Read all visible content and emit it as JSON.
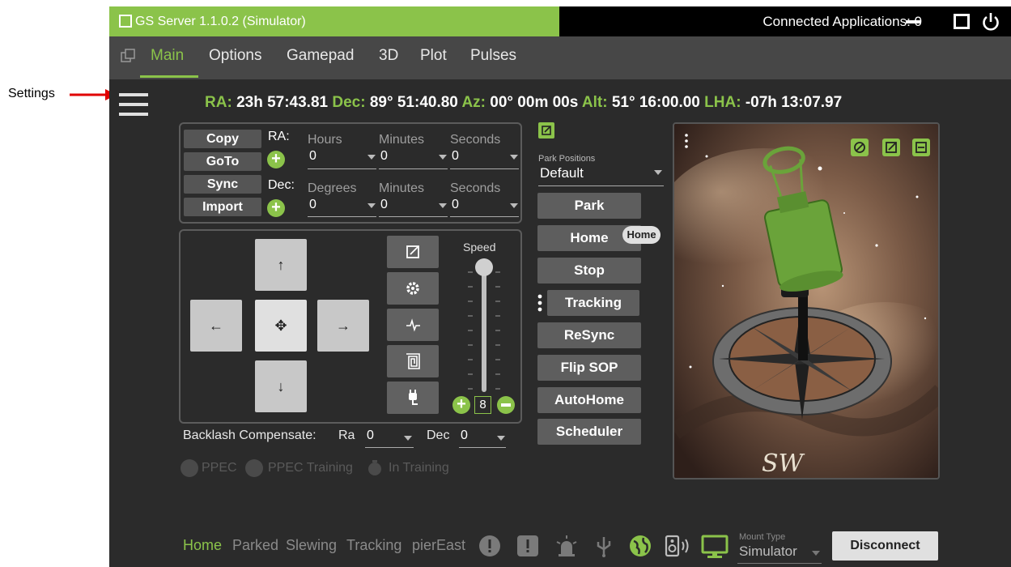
{
  "annotation": {
    "label": "Settings"
  },
  "window": {
    "title": "GS Server 1.1.0.2 (Simulator)",
    "connected_apps": "Connected Applications: 0"
  },
  "tabs": [
    "Main",
    "Options",
    "Gamepad",
    "3D",
    "Plot",
    "Pulses"
  ],
  "coords": {
    "ra_label": "RA:",
    "ra": "23h 57:43.81",
    "dec_label": "Dec:",
    "dec": "89° 51:40.80",
    "az_label": "Az:",
    "az": "00° 00m 00s",
    "alt_label": "Alt:",
    "alt": "51° 16:00.00",
    "lha_label": "LHA:",
    "lha": "-07h 13:07.97"
  },
  "goto": {
    "buttons": [
      "Copy",
      "GoTo",
      "Sync",
      "Import"
    ],
    "ra_label": "RA:",
    "dec_label": "Dec:",
    "ra_fields": [
      {
        "label": "Hours",
        "value": "0"
      },
      {
        "label": "Minutes",
        "value": "0"
      },
      {
        "label": "Seconds",
        "value": "0"
      }
    ],
    "dec_fields": [
      {
        "label": "Degrees",
        "value": "0"
      },
      {
        "label": "Minutes",
        "value": "0"
      },
      {
        "label": "Seconds",
        "value": "0"
      }
    ]
  },
  "move": {
    "speed_label": "Speed",
    "speed_value": "8",
    "speed_level": 1.0,
    "tool_icons": [
      "popout-icon",
      "gear-icon",
      "pulse-icon",
      "spiral-icon",
      "plug-icon"
    ]
  },
  "backlash": {
    "label": "Backlash Compensate:",
    "ra_label": "Ra",
    "ra_value": "0",
    "dec_label": "Dec",
    "dec_value": "0"
  },
  "ppec": {
    "ppec": "PPEC",
    "training": "PPEC Training",
    "in_training": "In Training"
  },
  "park": {
    "label": "Park Positions",
    "value": "Default",
    "buttons": [
      "Park",
      "Home",
      "Stop",
      "Tracking",
      "ReSync",
      "Flip SOP",
      "AutoHome",
      "Scheduler"
    ],
    "home_badge": "Home"
  },
  "status": {
    "items": [
      "Home",
      "Parked",
      "Slewing",
      "Tracking",
      "pierEast"
    ],
    "mount_type_label": "Mount Type",
    "mount_type": "Simulator",
    "disconnect": "Disconnect"
  },
  "view3d": {
    "logo": "SW"
  },
  "colors": {
    "accent": "#8bc34a",
    "background": "#2b2b2b",
    "menubar": "#474747"
  }
}
